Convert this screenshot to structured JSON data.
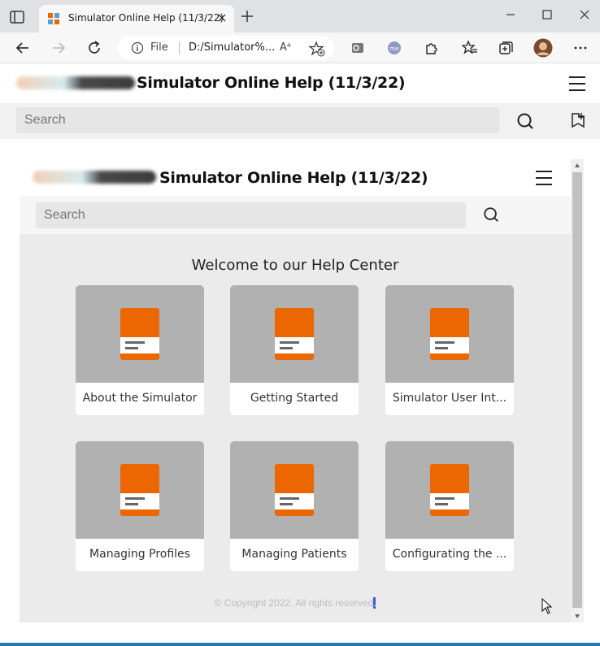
{
  "browser": {
    "tab_title": "Simulator Online Help (11/3/22)",
    "address_prefix": "File",
    "url": "D:/Simulator%...",
    "read_aloud_glyph": "Aᵃ",
    "icons": [
      "tab-actions-icon",
      "close-tab-icon",
      "new-tab-icon",
      "minimize-icon",
      "maximize-icon",
      "close-window-icon",
      "back-icon",
      "forward-icon",
      "refresh-icon",
      "info-icon",
      "read-aloud-icon",
      "add-favorite-icon",
      "outlook-icon",
      "extension-me-icon",
      "extensions-icon",
      "favorites-icon",
      "collections-icon",
      "profile-avatar",
      "more-icon"
    ]
  },
  "outer_page": {
    "title": "Simulator Online Help (11/3/22)",
    "search_placeholder": "Search"
  },
  "frame": {
    "title": "Simulator Online Help (11/3/22)",
    "search_placeholder": "Search",
    "welcome": "Welcome to our Help Center",
    "cards": [
      {
        "label": "About the Simulator"
      },
      {
        "label": "Getting Started"
      },
      {
        "label": "Simulator User Int..."
      },
      {
        "label": "Managing Profiles"
      },
      {
        "label": "Managing Patients"
      },
      {
        "label": "Configurating the ..."
      }
    ],
    "copyright": "© Copyright 2022. All rights reserved",
    "copyright_selected": "."
  },
  "colors": {
    "book_orange": "#ec6602",
    "card_image_bg": "#b1b1b1",
    "frame_bg": "#ebebeb",
    "accent_blue": "#1e7ab8"
  }
}
